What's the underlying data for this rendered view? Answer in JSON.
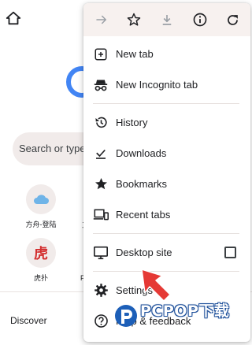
{
  "background": {
    "search_placeholder": "Search or type",
    "shortcuts": [
      {
        "label": "方舟-登陆",
        "icon": "cloud-icon"
      },
      {
        "label": "虎扑",
        "icon": "hupu-logo-icon",
        "glyph": "虎"
      }
    ],
    "partial_labels": [
      "工",
      "F"
    ],
    "discover_label": "Discover"
  },
  "menu": {
    "toolbar": [
      {
        "name": "forward",
        "icon": "forward-arrow-icon",
        "enabled": false
      },
      {
        "name": "bookmark",
        "icon": "star-outline-icon",
        "enabled": true
      },
      {
        "name": "download-page",
        "icon": "download-icon",
        "enabled": false
      },
      {
        "name": "page-info",
        "icon": "info-icon",
        "enabled": true
      },
      {
        "name": "reload",
        "icon": "reload-icon",
        "enabled": true
      }
    ],
    "groups": [
      [
        {
          "label": "New tab",
          "icon": "plus-box-icon"
        },
        {
          "label": "New Incognito tab",
          "icon": "incognito-icon"
        }
      ],
      [
        {
          "label": "History",
          "icon": "history-icon"
        },
        {
          "label": "Downloads",
          "icon": "downloads-check-icon"
        },
        {
          "label": "Bookmarks",
          "icon": "star-filled-icon"
        },
        {
          "label": "Recent tabs",
          "icon": "devices-icon"
        }
      ],
      [
        {
          "label": "Desktop site",
          "icon": "monitor-icon",
          "checked": false
        }
      ],
      [
        {
          "label": "Settings",
          "icon": "gear-icon"
        },
        {
          "label": "Help & feedback",
          "icon": "help-icon"
        }
      ]
    ]
  },
  "watermark": {
    "text": "PCPOP下载"
  },
  "colors": {
    "menu_top_bg": "#f7f1ef",
    "icon": "#202124",
    "disabled_icon": "#9aa0a6",
    "search_bg": "#f1ebea",
    "watermark_arrow": "#e53935",
    "watermark_blue": "#1d5fb8"
  }
}
